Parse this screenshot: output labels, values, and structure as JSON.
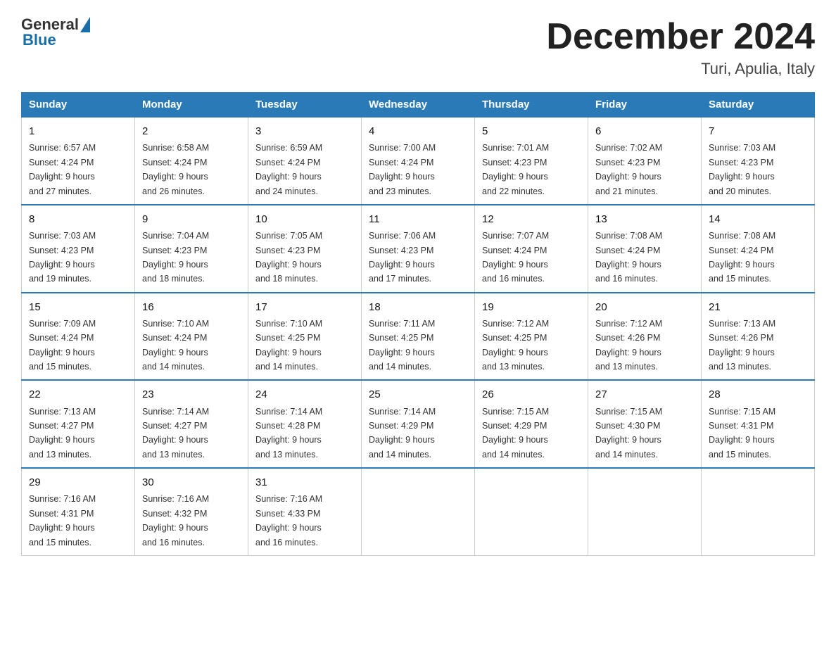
{
  "logo": {
    "general": "General",
    "blue": "Blue"
  },
  "title": "December 2024",
  "subtitle": "Turi, Apulia, Italy",
  "days_of_week": [
    "Sunday",
    "Monday",
    "Tuesday",
    "Wednesday",
    "Thursday",
    "Friday",
    "Saturday"
  ],
  "weeks": [
    [
      {
        "day": "1",
        "sunrise": "6:57 AM",
        "sunset": "4:24 PM",
        "daylight": "9 hours and 27 minutes."
      },
      {
        "day": "2",
        "sunrise": "6:58 AM",
        "sunset": "4:24 PM",
        "daylight": "9 hours and 26 minutes."
      },
      {
        "day": "3",
        "sunrise": "6:59 AM",
        "sunset": "4:24 PM",
        "daylight": "9 hours and 24 minutes."
      },
      {
        "day": "4",
        "sunrise": "7:00 AM",
        "sunset": "4:24 PM",
        "daylight": "9 hours and 23 minutes."
      },
      {
        "day": "5",
        "sunrise": "7:01 AM",
        "sunset": "4:23 PM",
        "daylight": "9 hours and 22 minutes."
      },
      {
        "day": "6",
        "sunrise": "7:02 AM",
        "sunset": "4:23 PM",
        "daylight": "9 hours and 21 minutes."
      },
      {
        "day": "7",
        "sunrise": "7:03 AM",
        "sunset": "4:23 PM",
        "daylight": "9 hours and 20 minutes."
      }
    ],
    [
      {
        "day": "8",
        "sunrise": "7:03 AM",
        "sunset": "4:23 PM",
        "daylight": "9 hours and 19 minutes."
      },
      {
        "day": "9",
        "sunrise": "7:04 AM",
        "sunset": "4:23 PM",
        "daylight": "9 hours and 18 minutes."
      },
      {
        "day": "10",
        "sunrise": "7:05 AM",
        "sunset": "4:23 PM",
        "daylight": "9 hours and 18 minutes."
      },
      {
        "day": "11",
        "sunrise": "7:06 AM",
        "sunset": "4:23 PM",
        "daylight": "9 hours and 17 minutes."
      },
      {
        "day": "12",
        "sunrise": "7:07 AM",
        "sunset": "4:24 PM",
        "daylight": "9 hours and 16 minutes."
      },
      {
        "day": "13",
        "sunrise": "7:08 AM",
        "sunset": "4:24 PM",
        "daylight": "9 hours and 16 minutes."
      },
      {
        "day": "14",
        "sunrise": "7:08 AM",
        "sunset": "4:24 PM",
        "daylight": "9 hours and 15 minutes."
      }
    ],
    [
      {
        "day": "15",
        "sunrise": "7:09 AM",
        "sunset": "4:24 PM",
        "daylight": "9 hours and 15 minutes."
      },
      {
        "day": "16",
        "sunrise": "7:10 AM",
        "sunset": "4:24 PM",
        "daylight": "9 hours and 14 minutes."
      },
      {
        "day": "17",
        "sunrise": "7:10 AM",
        "sunset": "4:25 PM",
        "daylight": "9 hours and 14 minutes."
      },
      {
        "day": "18",
        "sunrise": "7:11 AM",
        "sunset": "4:25 PM",
        "daylight": "9 hours and 14 minutes."
      },
      {
        "day": "19",
        "sunrise": "7:12 AM",
        "sunset": "4:25 PM",
        "daylight": "9 hours and 13 minutes."
      },
      {
        "day": "20",
        "sunrise": "7:12 AM",
        "sunset": "4:26 PM",
        "daylight": "9 hours and 13 minutes."
      },
      {
        "day": "21",
        "sunrise": "7:13 AM",
        "sunset": "4:26 PM",
        "daylight": "9 hours and 13 minutes."
      }
    ],
    [
      {
        "day": "22",
        "sunrise": "7:13 AM",
        "sunset": "4:27 PM",
        "daylight": "9 hours and 13 minutes."
      },
      {
        "day": "23",
        "sunrise": "7:14 AM",
        "sunset": "4:27 PM",
        "daylight": "9 hours and 13 minutes."
      },
      {
        "day": "24",
        "sunrise": "7:14 AM",
        "sunset": "4:28 PM",
        "daylight": "9 hours and 13 minutes."
      },
      {
        "day": "25",
        "sunrise": "7:14 AM",
        "sunset": "4:29 PM",
        "daylight": "9 hours and 14 minutes."
      },
      {
        "day": "26",
        "sunrise": "7:15 AM",
        "sunset": "4:29 PM",
        "daylight": "9 hours and 14 minutes."
      },
      {
        "day": "27",
        "sunrise": "7:15 AM",
        "sunset": "4:30 PM",
        "daylight": "9 hours and 14 minutes."
      },
      {
        "day": "28",
        "sunrise": "7:15 AM",
        "sunset": "4:31 PM",
        "daylight": "9 hours and 15 minutes."
      }
    ],
    [
      {
        "day": "29",
        "sunrise": "7:16 AM",
        "sunset": "4:31 PM",
        "daylight": "9 hours and 15 minutes."
      },
      {
        "day": "30",
        "sunrise": "7:16 AM",
        "sunset": "4:32 PM",
        "daylight": "9 hours and 16 minutes."
      },
      {
        "day": "31",
        "sunrise": "7:16 AM",
        "sunset": "4:33 PM",
        "daylight": "9 hours and 16 minutes."
      },
      null,
      null,
      null,
      null
    ]
  ]
}
